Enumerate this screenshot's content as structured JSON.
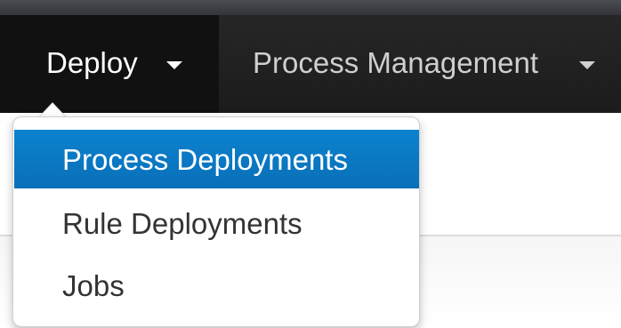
{
  "navbar": {
    "items": [
      {
        "label": "Deploy",
        "active": true,
        "has_caret": true,
        "icon": "caret-down-icon"
      },
      {
        "label": "Process Management",
        "active": false,
        "has_caret": true,
        "icon": "caret-down-icon"
      }
    ]
  },
  "dropdown": {
    "parent": "Deploy",
    "items": [
      {
        "label": "Process Deployments",
        "selected": true
      },
      {
        "label": "Rule Deployments",
        "selected": false
      },
      {
        "label": "Jobs",
        "selected": false
      }
    ]
  },
  "colors": {
    "navbar_background": "#1c1c1c",
    "navbar_active_background": "#111111",
    "navbar_text": "#c9c9c9",
    "navbar_active_text": "#ffffff",
    "menu_selected_background": "#0a73bf",
    "menu_text": "#333333"
  }
}
